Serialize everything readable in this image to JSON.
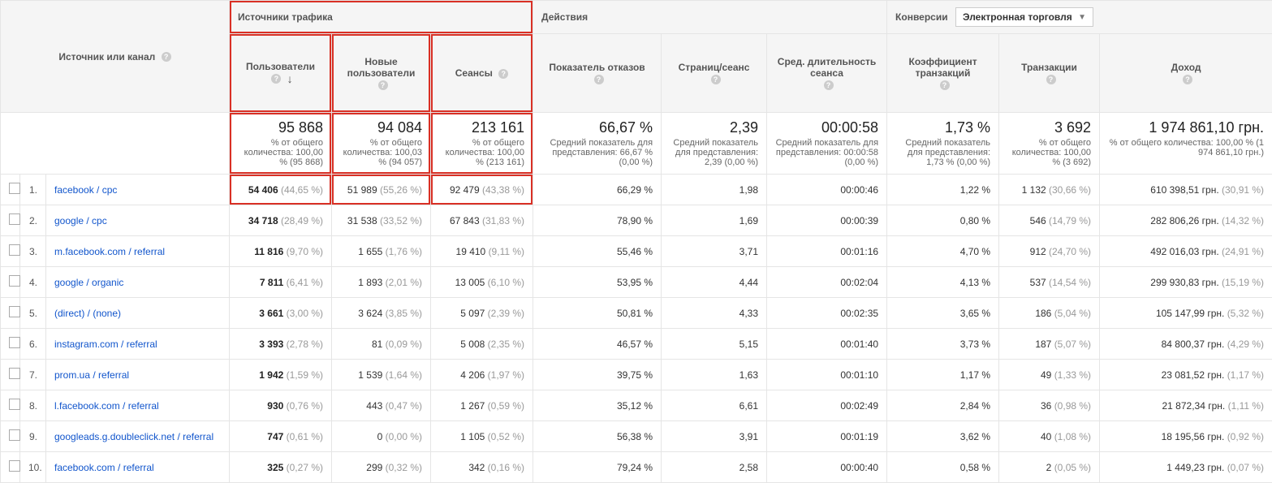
{
  "header": {
    "dimension": "Источник или канал",
    "groups": {
      "traffic": "Источники трафика",
      "actions": "Действия",
      "conversions": "Конверсии",
      "conversions_selected": "Электронная торговля"
    },
    "metrics": {
      "users": "Пользователи",
      "new_users": "Новые пользователи",
      "sessions": "Сеансы",
      "bounce": "Показатель отказов",
      "pps": "Страниц/сеанс",
      "duration": "Сред. длительность сеанса",
      "trans_rate": "Коэффициент транзакций",
      "trans": "Транзакции",
      "revenue": "Доход"
    }
  },
  "summary": {
    "users": {
      "big": "95 868",
      "sub": "% от общего количества: 100,00 % (95 868)"
    },
    "new_users": {
      "big": "94 084",
      "sub": "% от общего количества: 100,03 % (94 057)"
    },
    "sessions": {
      "big": "213 161",
      "sub": "% от общего количества: 100,00 % (213 161)"
    },
    "bounce": {
      "big": "66,67 %",
      "sub": "Средний показатель для представления: 66,67 % (0,00 %)"
    },
    "pps": {
      "big": "2,39",
      "sub": "Средний показатель для представления: 2,39 (0,00 %)"
    },
    "duration": {
      "big": "00:00:58",
      "sub": "Средний показатель для представления: 00:00:58 (0,00 %)"
    },
    "trans_rate": {
      "big": "1,73 %",
      "sub": "Средний показатель для представления: 1,73 % (0,00 %)"
    },
    "trans": {
      "big": "3 692",
      "sub": "% от общего количества: 100,00 % (3 692)"
    },
    "revenue": {
      "big": "1 974 861,10 грн.",
      "sub": "% от общего количества: 100,00 % (1 974 861,10 грн.)"
    }
  },
  "rows": [
    {
      "i": "1.",
      "src": "facebook / cpc",
      "users": "54 406",
      "users_p": "(44,65 %)",
      "new": "51 989",
      "new_p": "(55,26 %)",
      "sess": "92 479",
      "sess_p": "(43,38 %)",
      "bounce": "66,29 %",
      "pps": "1,98",
      "dur": "00:00:46",
      "tr": "1,22 %",
      "tx": "1 132",
      "tx_p": "(30,66 %)",
      "rev": "610 398,51 грн.",
      "rev_p": "(30,91 %)"
    },
    {
      "i": "2.",
      "src": "google / cpc",
      "users": "34 718",
      "users_p": "(28,49 %)",
      "new": "31 538",
      "new_p": "(33,52 %)",
      "sess": "67 843",
      "sess_p": "(31,83 %)",
      "bounce": "78,90 %",
      "pps": "1,69",
      "dur": "00:00:39",
      "tr": "0,80 %",
      "tx": "546",
      "tx_p": "(14,79 %)",
      "rev": "282 806,26 грн.",
      "rev_p": "(14,32 %)"
    },
    {
      "i": "3.",
      "src": "m.facebook.com / referral",
      "users": "11 816",
      "users_p": "(9,70 %)",
      "new": "1 655",
      "new_p": "(1,76 %)",
      "sess": "19 410",
      "sess_p": "(9,11 %)",
      "bounce": "55,46 %",
      "pps": "3,71",
      "dur": "00:01:16",
      "tr": "4,70 %",
      "tx": "912",
      "tx_p": "(24,70 %)",
      "rev": "492 016,03 грн.",
      "rev_p": "(24,91 %)"
    },
    {
      "i": "4.",
      "src": "google / organic",
      "users": "7 811",
      "users_p": "(6,41 %)",
      "new": "1 893",
      "new_p": "(2,01 %)",
      "sess": "13 005",
      "sess_p": "(6,10 %)",
      "bounce": "53,95 %",
      "pps": "4,44",
      "dur": "00:02:04",
      "tr": "4,13 %",
      "tx": "537",
      "tx_p": "(14,54 %)",
      "rev": "299 930,83 грн.",
      "rev_p": "(15,19 %)"
    },
    {
      "i": "5.",
      "src": "(direct) / (none)",
      "users": "3 661",
      "users_p": "(3,00 %)",
      "new": "3 624",
      "new_p": "(3,85 %)",
      "sess": "5 097",
      "sess_p": "(2,39 %)",
      "bounce": "50,81 %",
      "pps": "4,33",
      "dur": "00:02:35",
      "tr": "3,65 %",
      "tx": "186",
      "tx_p": "(5,04 %)",
      "rev": "105 147,99 грн.",
      "rev_p": "(5,32 %)"
    },
    {
      "i": "6.",
      "src": "instagram.com / referral",
      "users": "3 393",
      "users_p": "(2,78 %)",
      "new": "81",
      "new_p": "(0,09 %)",
      "sess": "5 008",
      "sess_p": "(2,35 %)",
      "bounce": "46,57 %",
      "pps": "5,15",
      "dur": "00:01:40",
      "tr": "3,73 %",
      "tx": "187",
      "tx_p": "(5,07 %)",
      "rev": "84 800,37 грн.",
      "rev_p": "(4,29 %)"
    },
    {
      "i": "7.",
      "src": "prom.ua / referral",
      "users": "1 942",
      "users_p": "(1,59 %)",
      "new": "1 539",
      "new_p": "(1,64 %)",
      "sess": "4 206",
      "sess_p": "(1,97 %)",
      "bounce": "39,75 %",
      "pps": "1,63",
      "dur": "00:01:10",
      "tr": "1,17 %",
      "tx": "49",
      "tx_p": "(1,33 %)",
      "rev": "23 081,52 грн.",
      "rev_p": "(1,17 %)"
    },
    {
      "i": "8.",
      "src": "l.facebook.com / referral",
      "users": "930",
      "users_p": "(0,76 %)",
      "new": "443",
      "new_p": "(0,47 %)",
      "sess": "1 267",
      "sess_p": "(0,59 %)",
      "bounce": "35,12 %",
      "pps": "6,61",
      "dur": "00:02:49",
      "tr": "2,84 %",
      "tx": "36",
      "tx_p": "(0,98 %)",
      "rev": "21 872,34 грн.",
      "rev_p": "(1,11 %)"
    },
    {
      "i": "9.",
      "src": "googleads.g.doubleclick.net / referral",
      "users": "747",
      "users_p": "(0,61 %)",
      "new": "0",
      "new_p": "(0,00 %)",
      "sess": "1 105",
      "sess_p": "(0,52 %)",
      "bounce": "56,38 %",
      "pps": "3,91",
      "dur": "00:01:19",
      "tr": "3,62 %",
      "tx": "40",
      "tx_p": "(1,08 %)",
      "rev": "18 195,56 грн.",
      "rev_p": "(0,92 %)"
    },
    {
      "i": "10.",
      "src": "facebook.com / referral",
      "users": "325",
      "users_p": "(0,27 %)",
      "new": "299",
      "new_p": "(0,32 %)",
      "sess": "342",
      "sess_p": "(0,16 %)",
      "bounce": "79,24 %",
      "pps": "2,58",
      "dur": "00:00:40",
      "tr": "0,58 %",
      "tx": "2",
      "tx_p": "(0,05 %)",
      "rev": "1 449,23 грн.",
      "rev_p": "(0,07 %)"
    }
  ],
  "chart_data": {
    "type": "table",
    "title": "Источник или канал",
    "columns": [
      "Источник или канал",
      "Пользователи",
      "Новые пользователи",
      "Сеансы",
      "Показатель отказов",
      "Страниц/сеанс",
      "Сред. длительность сеанса",
      "Коэффициент транзакций",
      "Транзакции",
      "Доход"
    ],
    "series": []
  }
}
